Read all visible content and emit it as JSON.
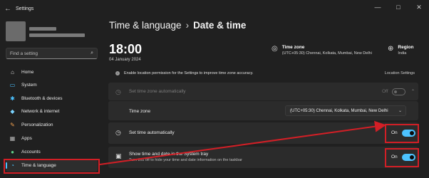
{
  "window": {
    "title": "Settings",
    "back_icon": "back-arrow-icon",
    "controls": {
      "minimize": "—",
      "maximize": "□",
      "close": "✕"
    }
  },
  "sidebar": {
    "search_placeholder": "Find a setting",
    "items": [
      {
        "label": "Home",
        "icon": "home-icon",
        "glyph": "⌂",
        "color": "#e0e0e0"
      },
      {
        "label": "System",
        "icon": "system-icon",
        "glyph": "▭",
        "color": "#4cc2ff"
      },
      {
        "label": "Bluetooth & devices",
        "icon": "bluetooth-icon",
        "glyph": "✱",
        "color": "#4cc2ff"
      },
      {
        "label": "Network & internet",
        "icon": "wifi-icon",
        "glyph": "◆",
        "color": "#7ad3ff"
      },
      {
        "label": "Personalization",
        "icon": "brush-icon",
        "glyph": "✎",
        "color": "#f0a050"
      },
      {
        "label": "Apps",
        "icon": "apps-icon",
        "glyph": "▦",
        "color": "#b8b8b8"
      },
      {
        "label": "Accounts",
        "icon": "accounts-icon",
        "glyph": "●",
        "color": "#5fd38a"
      },
      {
        "label": "Time & language",
        "icon": "globe-clock-icon",
        "glyph": "◔",
        "color": "#4cc2ff",
        "active": true
      }
    ]
  },
  "header": {
    "parent": "Time & language",
    "separator": "›",
    "current": "Date & time"
  },
  "clock": {
    "time": "18:00",
    "date": "04 January 2024"
  },
  "time_zone_summary": {
    "label": "Time zone",
    "value": "(UTC+05:30) Chennai, Kolkata, Mumbai, New Delhi"
  },
  "region_summary": {
    "label": "Region",
    "value": "India"
  },
  "location_notice": {
    "text": "Enable location permission for the Settings to improve time zone accuracy.",
    "link": "Location Settings"
  },
  "settings": {
    "auto_time_zone": {
      "label": "Set time zone automatically",
      "state": "Off",
      "enabled": false
    },
    "time_zone": {
      "label": "Time zone",
      "selected": "(UTC+05:30) Chennai, Kolkata, Mumbai, New Delhi"
    },
    "auto_time": {
      "label": "Set time automatically",
      "state": "On",
      "enabled": true
    },
    "tray": {
      "label": "Show time and date in the System tray",
      "sub": "Turn this off to hide your time and date information on the taskbar",
      "state": "On",
      "enabled": true
    }
  },
  "annotation": {
    "color": "#d21f26"
  }
}
